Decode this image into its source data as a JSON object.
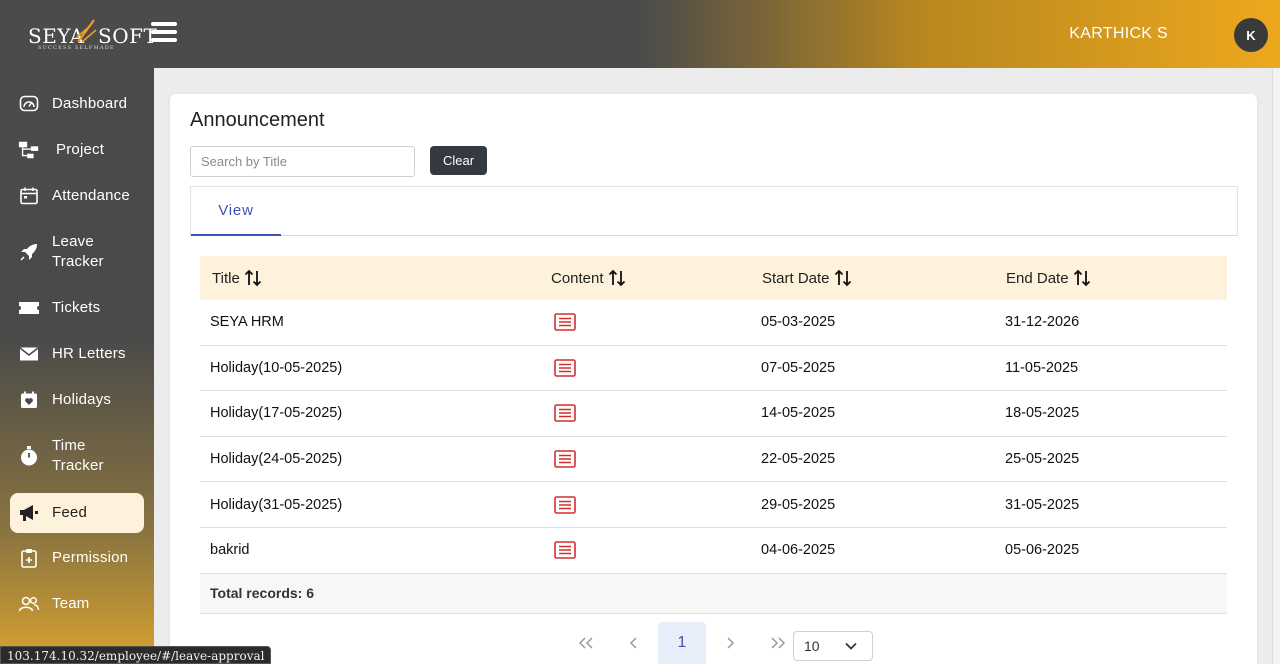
{
  "brand": {
    "name_left": "SEYA",
    "name_right": "SOFT",
    "tagline": "SUCCESS SELFMADE"
  },
  "user": {
    "name": "KARTHICK S",
    "initial": "K"
  },
  "sidebar": {
    "items": [
      {
        "label": "Dashboard",
        "icon": "dashboard-icon"
      },
      {
        "label": "Project",
        "icon": "project-icon"
      },
      {
        "label": "Attendance",
        "icon": "calendar-icon"
      },
      {
        "label": "Leave Tracker",
        "icon": "rocket-icon"
      },
      {
        "label": "Tickets",
        "icon": "ticket-icon"
      },
      {
        "label": "HR Letters",
        "icon": "envelope-icon"
      },
      {
        "label": "Holidays",
        "icon": "calendar-heart-icon"
      },
      {
        "label": "Time Tracker",
        "icon": "stopwatch-icon"
      },
      {
        "label": "Feed",
        "icon": "megaphone-icon",
        "active": true
      },
      {
        "label": "Permission",
        "icon": "clipboard-icon"
      },
      {
        "label": "Team",
        "icon": "team-icon"
      }
    ]
  },
  "main": {
    "title": "Announcement",
    "search": {
      "placeholder": "Search by Title",
      "value": ""
    },
    "clear_label": "Clear",
    "tab": "View"
  },
  "table": {
    "columns": [
      "Title",
      "Content",
      "Start Date",
      "End Date"
    ],
    "rows": [
      {
        "title": "SEYA HRM",
        "start": "05-03-2025",
        "end": "31-12-2026"
      },
      {
        "title": "Holiday(10-05-2025)",
        "start": "07-05-2025",
        "end": "11-05-2025"
      },
      {
        "title": "Holiday(17-05-2025)",
        "start": "14-05-2025",
        "end": "18-05-2025"
      },
      {
        "title": "Holiday(24-05-2025)",
        "start": "22-05-2025",
        "end": "25-05-2025"
      },
      {
        "title": "Holiday(31-05-2025)",
        "start": "29-05-2025",
        "end": "31-05-2025"
      },
      {
        "title": "bakrid",
        "start": "04-06-2025",
        "end": "05-06-2025"
      }
    ],
    "total_label": "Total records: 6"
  },
  "pagination": {
    "current_page": "1",
    "per_page": "10"
  },
  "status_url": "103.174.10.32/employee/#/leave-approval",
  "colors": {
    "accent": "#3f51b5",
    "brand_gold": "#eda81e",
    "content_icon": "#d32f2f",
    "header_row": "#fef2dc"
  }
}
